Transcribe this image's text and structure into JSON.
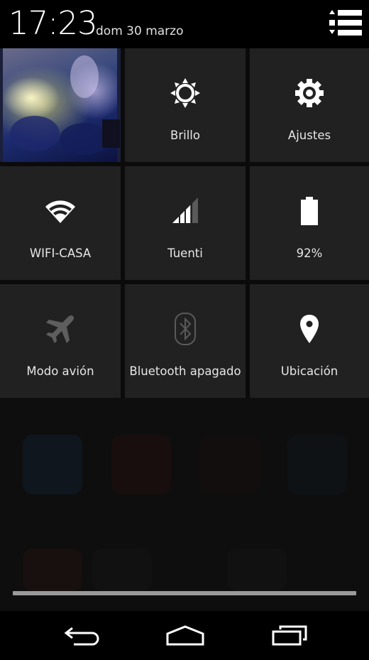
{
  "status_bar": {
    "time": "17:23",
    "date": "dom 30 marzo"
  },
  "quick_settings": {
    "tiles": [
      {
        "id": "user",
        "label": "",
        "icon": "user-photo"
      },
      {
        "id": "brightness",
        "label": "Brillo",
        "icon": "brightness-icon"
      },
      {
        "id": "settings",
        "label": "Ajustes",
        "icon": "gear-icon"
      },
      {
        "id": "wifi",
        "label": "WIFI-CASA",
        "icon": "wifi-icon"
      },
      {
        "id": "mobile",
        "label": "Tuenti",
        "icon": "signal-icon"
      },
      {
        "id": "battery",
        "label": "92%",
        "icon": "battery-icon",
        "level": 0.92
      },
      {
        "id": "airplane",
        "label": "Modo avión",
        "icon": "airplane-icon"
      },
      {
        "id": "bluetooth",
        "label": "Bluetooth apagado",
        "icon": "bluetooth-icon"
      },
      {
        "id": "location",
        "label": "Ubicación",
        "icon": "location-pin-icon"
      }
    ]
  },
  "colors": {
    "tile_bg": "#212121",
    "icon_active": "#ffffff",
    "icon_inactive": "#5a5a5a"
  }
}
